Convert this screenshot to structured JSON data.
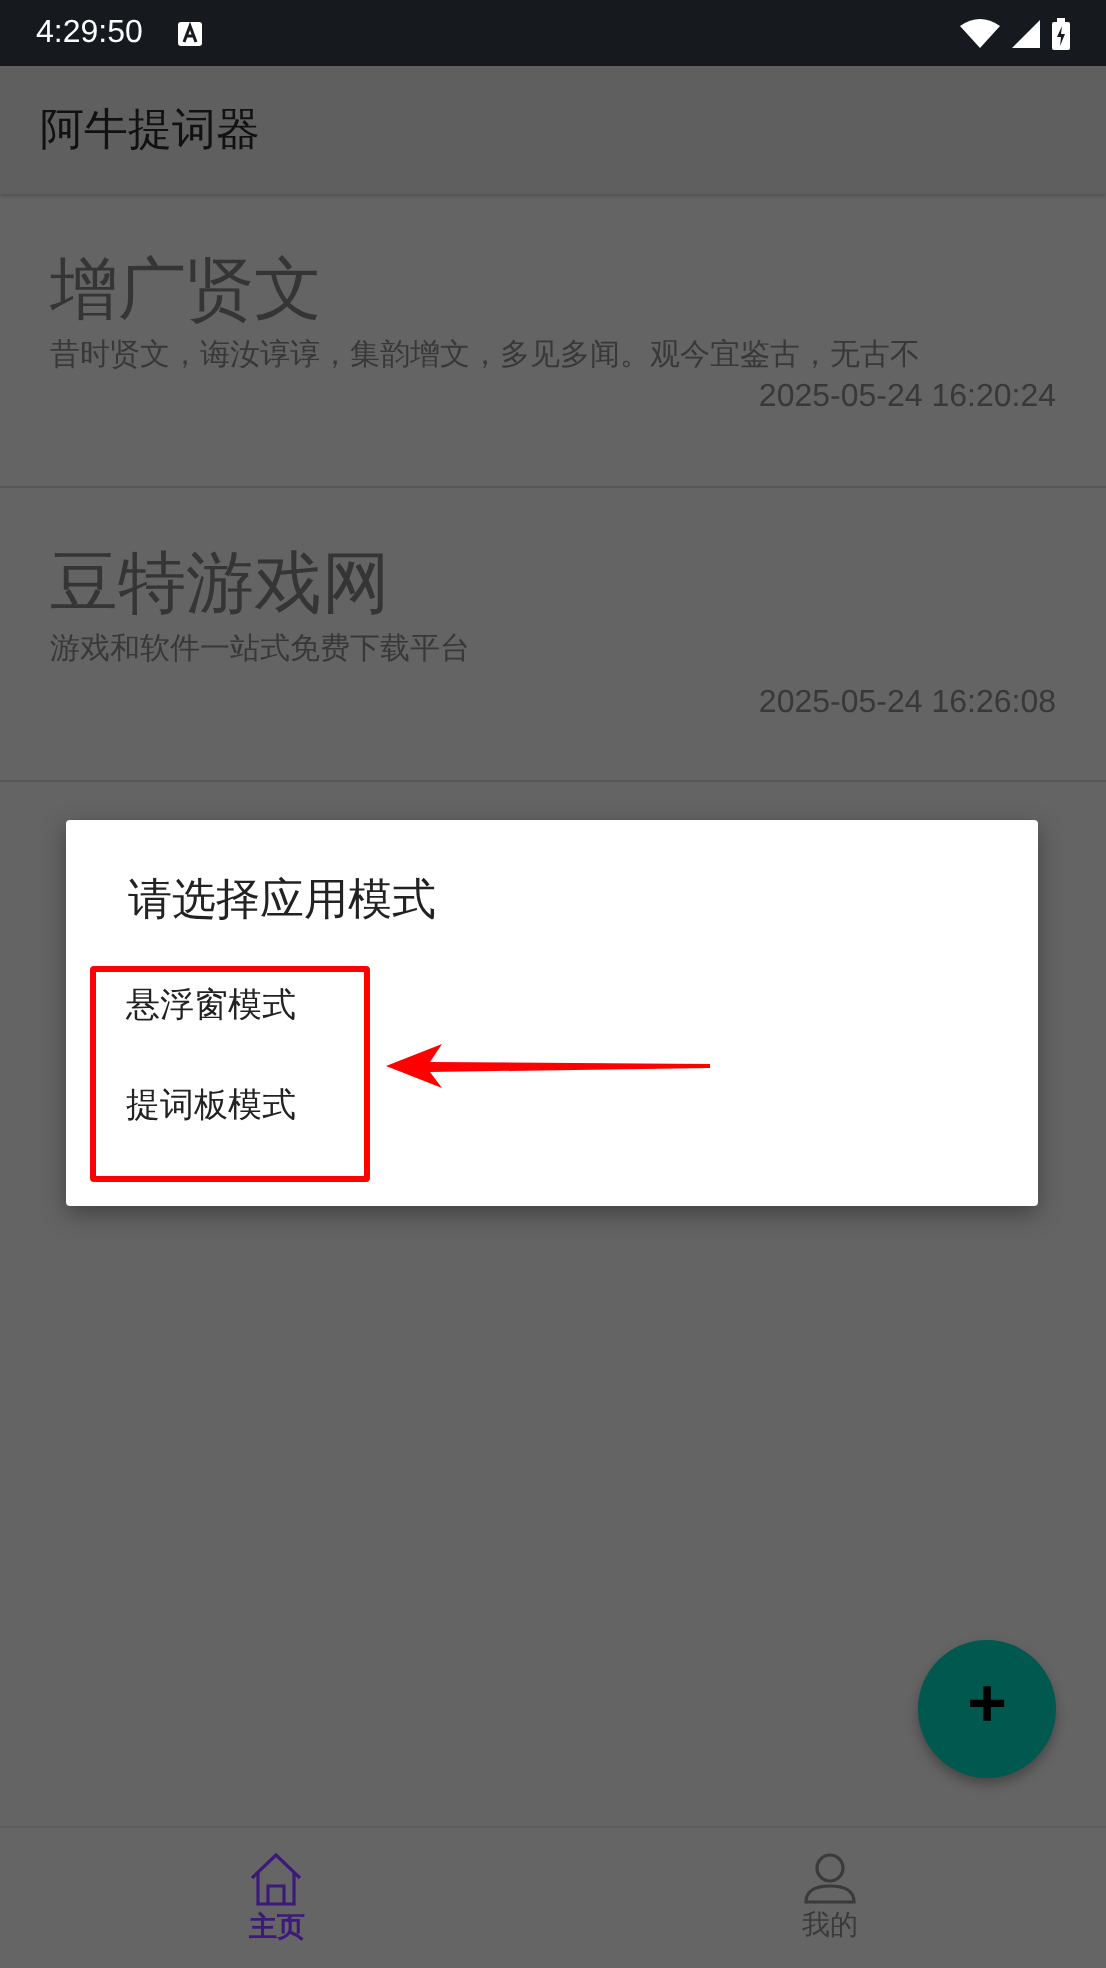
{
  "status_bar": {
    "time": "4:29:50"
  },
  "app_bar": {
    "title": "阿牛提词器"
  },
  "items": [
    {
      "title": "增广贤文",
      "description": "昔时贤文，诲汝谆谆，集韵增文，多见多闻。观今宜鉴古，无古不",
      "date": "2025-05-24 16:20:24"
    },
    {
      "title": "豆特游戏网",
      "description": "游戏和软件一站式免费下载平台",
      "date": "2025-05-24 16:26:08"
    }
  ],
  "dialog": {
    "title": "请选择应用模式",
    "options": [
      {
        "label": "悬浮窗模式"
      },
      {
        "label": "提词板模式"
      }
    ]
  },
  "fab": {
    "label": "+"
  },
  "bottom_nav": [
    {
      "label": "主页",
      "kind": "home",
      "selected": true
    },
    {
      "label": "我的",
      "kind": "profile",
      "selected": false
    }
  ]
}
